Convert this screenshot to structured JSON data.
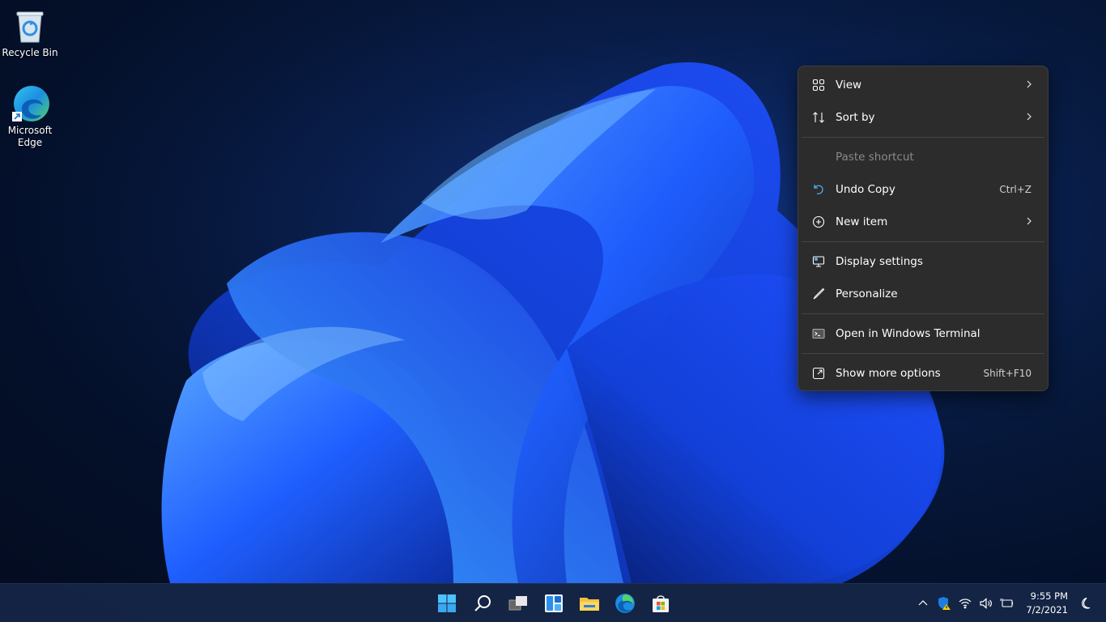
{
  "desktop": {
    "icons": [
      {
        "label": "Recycle Bin",
        "icon": "recycle-bin-icon"
      },
      {
        "label": "Microsoft Edge",
        "icon": "edge-icon"
      }
    ]
  },
  "context_menu": {
    "items": [
      {
        "label": "View",
        "icon": "view-grid-icon",
        "submenu": true
      },
      {
        "label": "Sort by",
        "icon": "sort-icon",
        "submenu": true
      },
      {
        "label": "Paste shortcut",
        "disabled": true
      },
      {
        "label": "Undo Copy",
        "icon": "undo-icon",
        "shortcut": "Ctrl+Z"
      },
      {
        "label": "New item",
        "icon": "add-circle-icon",
        "submenu": true
      },
      {
        "label": "Display settings",
        "icon": "display-icon"
      },
      {
        "label": "Personalize",
        "icon": "brush-icon"
      },
      {
        "label": "Open in Windows Terminal",
        "icon": "terminal-icon"
      },
      {
        "label": "Show more options",
        "icon": "share-open-icon",
        "shortcut": "Shift+F10"
      }
    ]
  },
  "taskbar": {
    "apps": [
      "start-icon",
      "search-icon",
      "task-view-icon",
      "widgets-icon",
      "file-explorer-icon",
      "edge-icon",
      "store-icon"
    ],
    "tray": [
      "chevron-up-icon",
      "security-warning-icon",
      "wifi-icon",
      "volume-icon",
      "battery-plug-icon"
    ],
    "clock": {
      "time": "9:55 PM",
      "date": "7/2/2021"
    },
    "focus_assist_icon": "moon-icon"
  },
  "colors": {
    "menu_bg": "#2c2c2c",
    "accent": "#0a5fd8",
    "wallpaper_dark": "#04102a"
  }
}
